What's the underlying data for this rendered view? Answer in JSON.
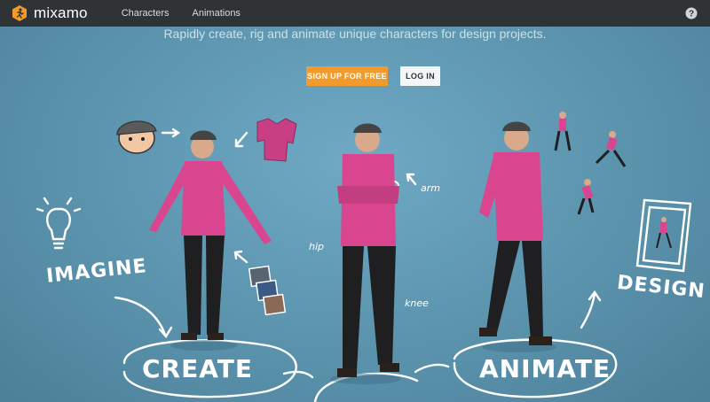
{
  "header": {
    "brand": "mixamo",
    "nav": [
      {
        "label": "Characters"
      },
      {
        "label": "Animations"
      }
    ],
    "help_icon": "question-circle-icon"
  },
  "hero": {
    "tagline": "Rapidly create, rig and animate unique characters for design projects.",
    "signup_label": "SIGN UP FOR FREE",
    "login_label": "LOG IN"
  },
  "illustration": {
    "labels": {
      "imagine": "IMAGINE",
      "create": "CREATE",
      "animate": "ANIMATE",
      "design": "DESIGN",
      "arm": "arm",
      "hip": "hip",
      "knee": "knee"
    }
  },
  "colors": {
    "topbar": "#2f3336",
    "accent": "#f39b2a",
    "background": "#5b93ad",
    "shirt": "#d9468f",
    "pants": "#1f1f22"
  }
}
